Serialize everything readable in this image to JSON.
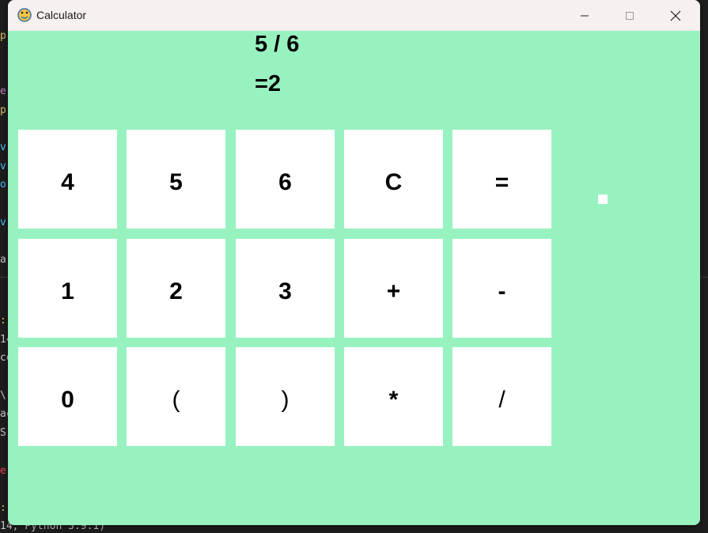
{
  "window": {
    "title": "Calculator"
  },
  "display": {
    "expression": "5 / 6",
    "result": "=2"
  },
  "keypad": {
    "rows": [
      [
        "4",
        "5",
        "6",
        "C",
        "="
      ],
      [
        "1",
        "2",
        "3",
        "+",
        "-"
      ],
      [
        "0",
        "(",
        ")",
        "*",
        "/"
      ]
    ]
  },
  "background": {
    "editor_left_chars": [
      "p",
      "",
      "e",
      "p",
      "",
      "v",
      "v",
      "o",
      "",
      "v",
      "",
      "a"
    ],
    "terminal_left_chars": [
      ":",
      "14",
      "co",
      "",
      "\\",
      "ac",
      "S",
      "",
      "e",
      "",
      ":"
    ],
    "bottom_line": "14, Python 3.9.1)"
  },
  "colors": {
    "window_bg": "#98f2c0",
    "key_bg": "#ffffff",
    "titlebar_bg": "#f6f0ee",
    "text": "#000000"
  }
}
